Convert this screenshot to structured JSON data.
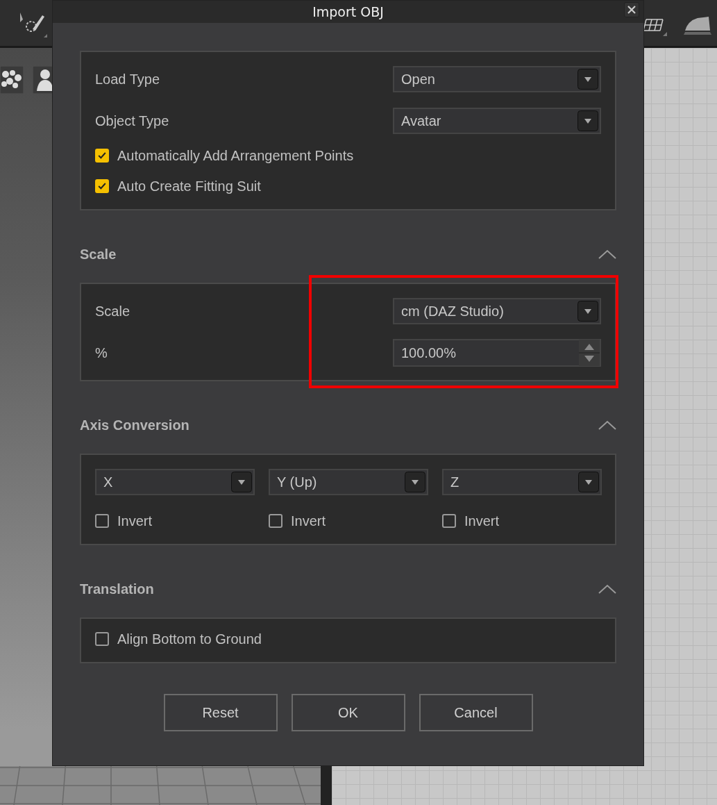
{
  "window": {
    "title": "Import OBJ"
  },
  "sections": [
    {
      "items": [
        {
          "kind": "dropdown",
          "label": "Load Type",
          "value": "Open"
        },
        {
          "kind": "dropdown",
          "label": "Object Type",
          "value": "Avatar"
        },
        {
          "kind": "checkbox",
          "label": "Automatically Add Arrangement Points",
          "checked": true
        },
        {
          "kind": "checkbox",
          "label": "Auto Create Fitting Suit",
          "checked": true
        }
      ]
    },
    {
      "heading": "Scale",
      "expanded": true,
      "highlighted": true,
      "items": [
        {
          "kind": "dropdown",
          "label": "Scale",
          "value": "cm (DAZ Studio)"
        },
        {
          "kind": "spinner",
          "label": "%",
          "value": "100.00%"
        }
      ]
    },
    {
      "heading": "Axis Conversion",
      "expanded": true,
      "axes": [
        {
          "value": "X",
          "invert_label": "Invert",
          "checked": false
        },
        {
          "value": "Y (Up)",
          "invert_label": "Invert",
          "checked": false
        },
        {
          "value": "Z",
          "invert_label": "Invert",
          "checked": false
        }
      ]
    },
    {
      "heading": "Translation",
      "expanded": true,
      "items": [
        {
          "kind": "checkbox",
          "label": "Align Bottom to Ground",
          "checked": false
        }
      ]
    }
  ],
  "buttons": [
    "Reset",
    "OK",
    "Cancel"
  ]
}
